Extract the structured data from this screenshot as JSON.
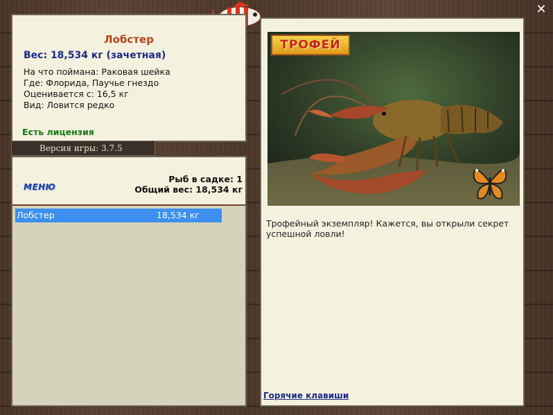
{
  "info": {
    "fish_name": "Лобстер",
    "weight_line": "Вес: 18,534 кг (зачетная)",
    "caught_on": "На что поймана: Раковая шейка",
    "location": "Где: Флорида, Паучье гнездо",
    "rated_from": "Оценивается с: 16,5 кг",
    "kind": "Вид: Ловится редко",
    "license": "Есть лицензия"
  },
  "version": {
    "label": "Версия игры: 3.7.5"
  },
  "list_panel": {
    "menu_label": "МЕНЮ",
    "cage_count": "Рыб в садке: 1",
    "total_weight": "Общий вес: 18,534 кг",
    "rows": [
      {
        "name": "Лобстер",
        "weight": "18,534 кг"
      }
    ]
  },
  "detail": {
    "badge": "ТРОФЕЙ",
    "description": "Трофейный экземпляр! Кажется, вы открыли секрет успешной ловли!",
    "hotkeys": "Горячие клавиши"
  },
  "icons": {
    "close": "close-icon",
    "fish": "fish-icon",
    "butterfly": "butterfly-icon"
  },
  "colors": {
    "panel_bg": "#f5f1df",
    "selected_row": "#3d8ff0",
    "fish_name": "#b5441a",
    "weight": "#1a2a8a",
    "license": "#167a16"
  }
}
